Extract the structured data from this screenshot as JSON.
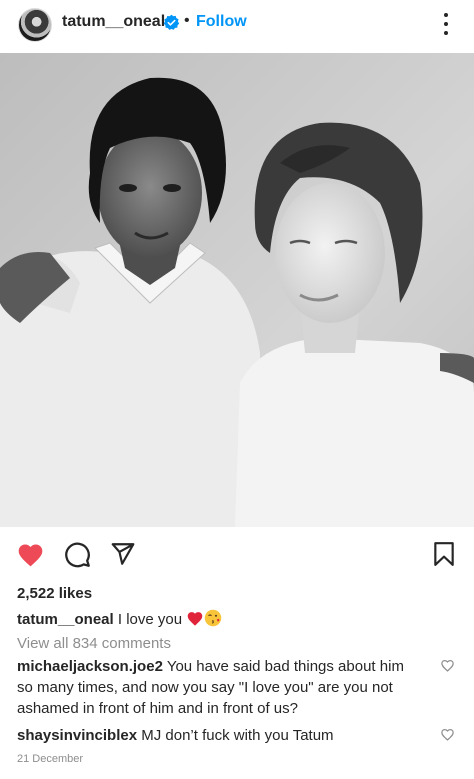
{
  "post": {
    "username": "tatum__oneal",
    "separator": "•",
    "follow_label": "Follow",
    "likes": "2,522 likes",
    "caption_user": "tatum__oneal",
    "caption_text": "I love you",
    "view_all": "View all 834 comments",
    "date": "21 December"
  },
  "comments": [
    {
      "user": "michaeljackson.joe2",
      "text": "You have said bad things about him so many times, and now you say \"I love you\" are you not ashamed in front of him and in front of us?"
    },
    {
      "user": "shaysinvinciblex",
      "text": "MJ don’t fuck with you Tatum"
    }
  ],
  "icons": {
    "verified": "verified-badge-icon",
    "more": "more-options-icon",
    "like": "heart-filled-icon",
    "comment": "comment-bubble-icon",
    "share": "paper-plane-icon",
    "save": "bookmark-icon",
    "comment_like": "heart-outline-icon",
    "emoji_1": "red-heart-emoji",
    "emoji_2": "kiss-face-emoji"
  },
  "colors": {
    "link_blue": "#0095f6",
    "like_red": "#ed4956",
    "muted_gray": "#8e8e8e",
    "text": "#262626"
  }
}
